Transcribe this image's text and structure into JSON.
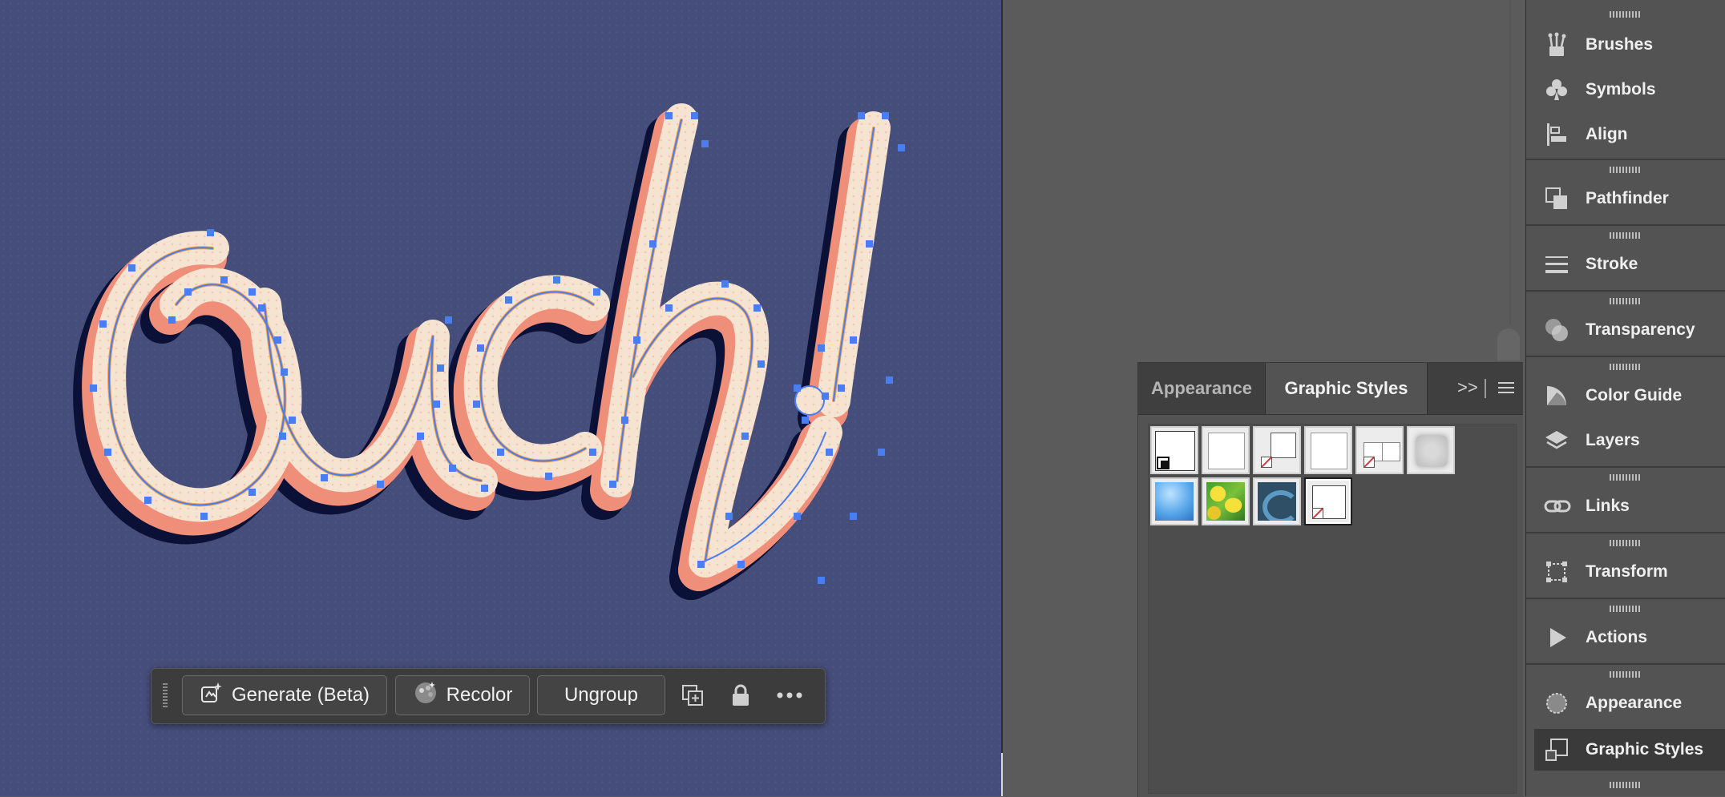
{
  "canvas": {
    "background_color": "#454d7a",
    "artwork_text": "Ouch!"
  },
  "taskbar": {
    "generate_label": "Generate (Beta)",
    "recolor_label": "Recolor",
    "ungroup_label": "Ungroup",
    "icons": [
      "duplicate-icon",
      "lock-icon",
      "more-options-icon"
    ]
  },
  "graphic_styles_panel": {
    "tabs": [
      {
        "label": "Appearance",
        "active": false
      },
      {
        "label": "Graphic Styles",
        "active": true
      }
    ],
    "controls": {
      "collapse": ">>",
      "menu": "panel-menu-icon"
    },
    "swatches": [
      {
        "id": "default-style"
      },
      {
        "id": "blank-white"
      },
      {
        "id": "no-fill-stroke"
      },
      {
        "id": "plain-white"
      },
      {
        "id": "no-fill-double"
      },
      {
        "id": "soft-shadow"
      },
      {
        "id": "blue-gradient"
      },
      {
        "id": "green-yellow-marble"
      },
      {
        "id": "blue-swirl"
      },
      {
        "id": "selected-no-fill",
        "selected": true
      }
    ]
  },
  "dock": {
    "items": [
      {
        "label": "Brushes",
        "icon": "brushes-icon"
      },
      {
        "label": "Symbols",
        "icon": "symbols-icon"
      },
      {
        "label": "Align",
        "icon": "align-icon"
      },
      {
        "label": "Pathfinder",
        "icon": "pathfinder-icon"
      },
      {
        "label": "Stroke",
        "icon": "stroke-icon"
      },
      {
        "label": "Transparency",
        "icon": "transparency-icon"
      },
      {
        "label": "Color Guide",
        "icon": "color-guide-icon"
      },
      {
        "label": "Layers",
        "icon": "layers-icon"
      },
      {
        "label": "Links",
        "icon": "links-icon"
      },
      {
        "label": "Transform",
        "icon": "transform-icon"
      },
      {
        "label": "Actions",
        "icon": "actions-icon"
      },
      {
        "label": "Appearance",
        "icon": "appearance-icon"
      },
      {
        "label": "Graphic Styles",
        "icon": "graphic-styles-icon",
        "active": true
      }
    ]
  }
}
